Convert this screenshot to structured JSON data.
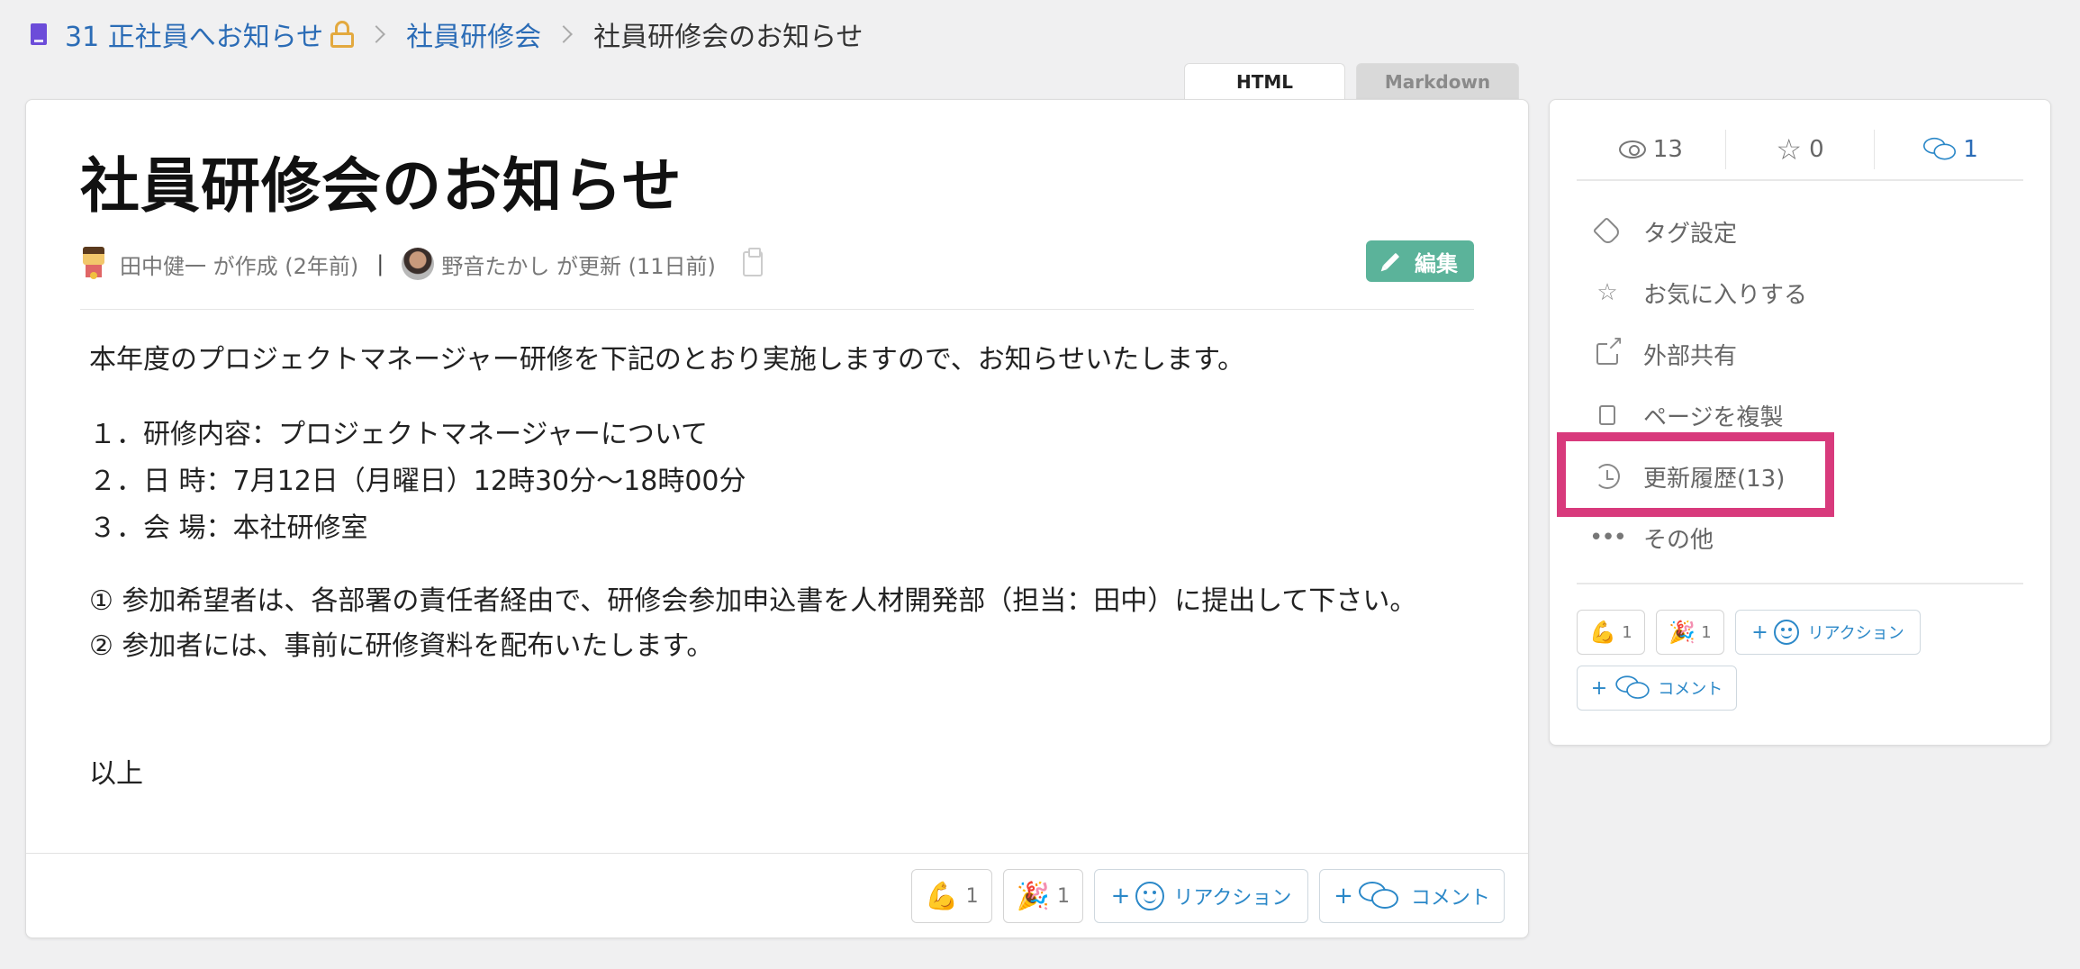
{
  "breadcrumb": {
    "book": "31 正社員へお知らせ",
    "section": "社員研修会",
    "current": "社員研修会のお知らせ"
  },
  "tabs": {
    "html": "HTML",
    "markdown": "Markdown"
  },
  "page": {
    "title": "社員研修会のお知らせ",
    "creator": "田中健一 が作成 (2年前)",
    "separator": "|",
    "updater": "野音たかし が更新 (11日前)",
    "edit_label": "編集",
    "intro": "本年度のプロジェクトマネージャー研修を下記のとおり実施しますので、お知らせいたします。",
    "list": [
      "１．研修内容：プロジェクトマネージャーについて",
      "２．日 時：7月12日（月曜日）12時30分〜18時00分",
      "３．会 場：本社研修室"
    ],
    "notes": [
      "① 参加希望者は、各部署の責任者経由で、研修会参加申込書を人材開発部（担当：田中）に提出して下さい。",
      "② 参加者には、事前に研修資料を配布いたします。"
    ],
    "closing": "以上"
  },
  "reactions": {
    "items": [
      {
        "emoji": "💪",
        "count": "1"
      },
      {
        "emoji": "🎉",
        "count": "1"
      }
    ],
    "plus": "+",
    "add_reaction": "リアクション",
    "add_comment": "コメント"
  },
  "sidebar": {
    "stats": {
      "views": "13",
      "stars": "0",
      "comments": "1"
    },
    "menu": [
      {
        "label": "タグ設定",
        "icon": "tag-icon"
      },
      {
        "label": "お気に入りする",
        "icon": "star-icon"
      },
      {
        "label": "外部共有",
        "icon": "external-share-icon"
      },
      {
        "label": "ページを複製",
        "icon": "copy-icon"
      },
      {
        "label": "更新履歴(13)",
        "icon": "history-icon"
      },
      {
        "label": "その他",
        "icon": "more-dots-icon"
      }
    ]
  },
  "colors": {
    "accent_link": "#2b6cb6",
    "edit_button": "#5bb39a",
    "highlight": "#d83a7c",
    "book_icon": "#6c4cd9"
  }
}
